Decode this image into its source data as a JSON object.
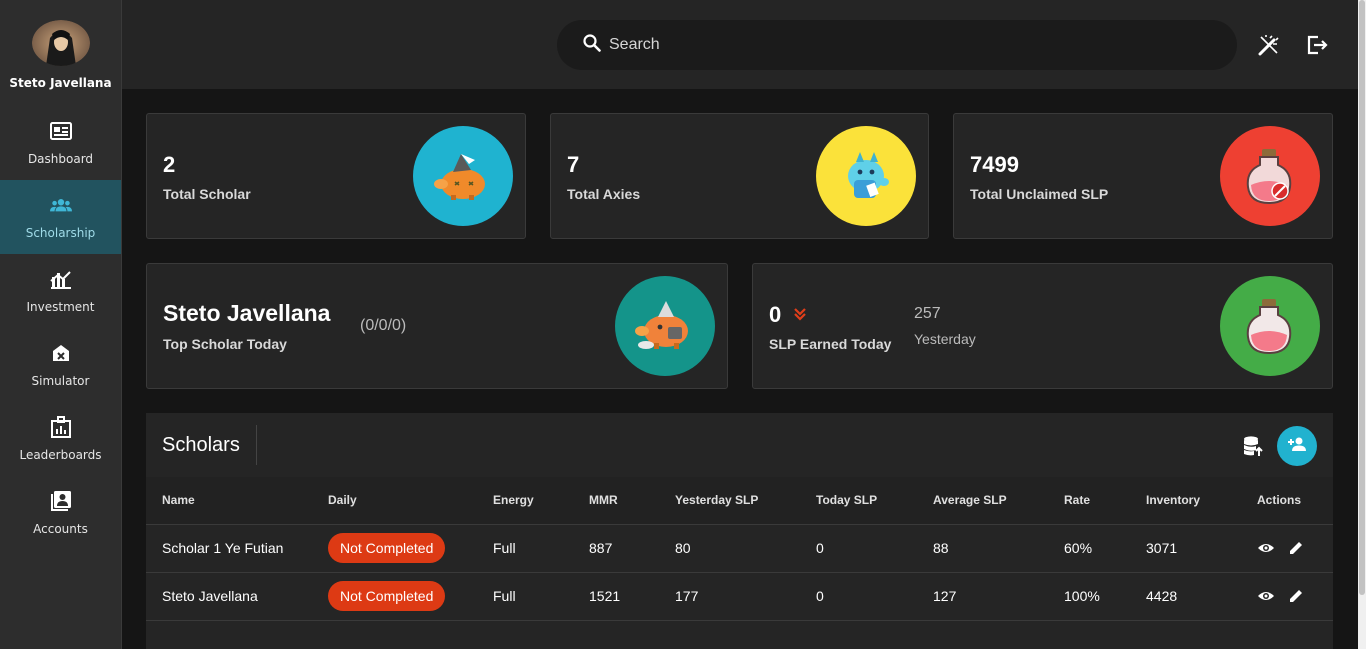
{
  "sidebar": {
    "profile_name": "Steto Javellana",
    "items": [
      {
        "label": "Dashboard",
        "icon": "dashboard-icon"
      },
      {
        "label": "Scholarship",
        "icon": "people-icon",
        "active": true
      },
      {
        "label": "Investment",
        "icon": "investment-icon"
      },
      {
        "label": "Simulator",
        "icon": "simulator-icon"
      },
      {
        "label": "Leaderboards",
        "icon": "leaderboards-icon"
      },
      {
        "label": "Accounts",
        "icon": "accounts-icon"
      }
    ]
  },
  "topbar": {
    "search_placeholder": "Search",
    "icons": [
      "theme-toggle-icon",
      "logout-icon"
    ]
  },
  "stats": {
    "total_scholar": {
      "value": "2",
      "label": "Total Scholar",
      "color": "#1fb3d0"
    },
    "total_axies": {
      "value": "7",
      "label": "Total Axies",
      "color": "#fbe23a"
    },
    "total_unclaimed": {
      "value": "7499",
      "label": "Total Unclaimed SLP",
      "color": "#ee4032"
    },
    "top_scholar": {
      "name": "Steto Javellana",
      "label": "Top Scholar Today",
      "record": "(0/0/0)",
      "color": "#14948a"
    },
    "slp_today": {
      "value": "0",
      "label": "SLP Earned Today",
      "yesterday_value": "257",
      "yesterday_label": "Yesterday",
      "color": "#44ac47"
    }
  },
  "scholars": {
    "title": "Scholars",
    "columns": [
      "Name",
      "Daily",
      "Energy",
      "MMR",
      "Yesterday SLP",
      "Today SLP",
      "Average SLP",
      "Rate",
      "Inventory",
      "Actions"
    ],
    "rows": [
      {
        "name": "Scholar 1 Ye Futian",
        "daily": "Not Completed",
        "energy": "Full",
        "mmr": "887",
        "yesterday_slp": "80",
        "today_slp": "0",
        "average_slp": "88",
        "rate": "60%",
        "inventory": "3071"
      },
      {
        "name": "Steto Javellana",
        "daily": "Not Completed",
        "energy": "Full",
        "mmr": "1521",
        "yesterday_slp": "177",
        "today_slp": "0",
        "average_slp": "127",
        "rate": "100%",
        "inventory": "4428"
      }
    ]
  },
  "colors": {
    "accent": "#21b2cf",
    "badge": "#dd3a14",
    "active_nav": "#22535f"
  }
}
